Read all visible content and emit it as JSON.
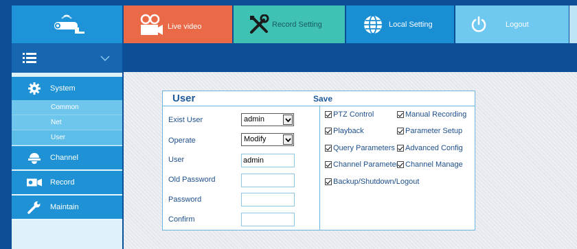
{
  "nav": {
    "live_video": "Live video",
    "record_setting": "Record Setting",
    "local_setting": "Local Setting",
    "logout": "Logout"
  },
  "sidebar": {
    "system": "System",
    "system_items": [
      "Common",
      "Net",
      "User"
    ],
    "channel": "Channel",
    "record": "Record",
    "maintain": "Maintain"
  },
  "panel": {
    "title": "User",
    "save": "Save",
    "fields": {
      "exist_user": {
        "label": "Exist User",
        "value": "admin"
      },
      "operate": {
        "label": "Operate",
        "value": "Modify"
      },
      "user": {
        "label": "User",
        "value": "admin"
      },
      "old_password": {
        "label": "Old Password",
        "value": ""
      },
      "password": {
        "label": "Password",
        "value": ""
      },
      "confirm": {
        "label": "Confirm",
        "value": ""
      }
    },
    "permissions": {
      "ptz_control": "PTZ Control",
      "manual_recording": "Manual Recording",
      "playback": "Playback",
      "parameter_setup": "Parameter Setup",
      "query_parameters": "Query Parameters",
      "advanced_config": "Advanced Config",
      "channel_parameters": "Channel Parameters",
      "channel_manage": "Channel Manage",
      "backup_shutdown_logout": "Backup/Shutdown/Logout"
    }
  },
  "colors": {
    "header_bg": "#0c4f96",
    "live_video": "#ea6947",
    "record_setting": "#3fc1b3",
    "local_setting": "#1a8ed3",
    "logout": "#6ec8f0",
    "sidebar_section": "#1f92d5",
    "sidebar_sub": "#6fc6ed"
  }
}
